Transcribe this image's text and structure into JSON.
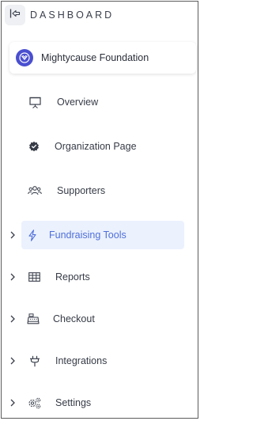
{
  "header": {
    "title": "DASHBOARD"
  },
  "org": {
    "name": "Mightycause Foundation"
  },
  "nav": [
    {
      "label": "Overview"
    },
    {
      "label": "Organization Page"
    },
    {
      "label": "Supporters"
    },
    {
      "label": "Fundraising Tools",
      "active": true
    },
    {
      "label": "Reports"
    },
    {
      "label": "Checkout"
    },
    {
      "label": "Integrations"
    },
    {
      "label": "Settings"
    }
  ],
  "icons": {
    "collapse": "collapse-left-icon",
    "overview": "presentation-icon",
    "organization_page": "verified-badge-icon",
    "supporters": "users-group-icon",
    "fundraising_tools": "lightning-bolt-icon",
    "reports": "table-icon",
    "checkout": "cash-register-icon",
    "integrations": "plug-icon",
    "settings": "gears-icon",
    "expand": "chevron-right-icon"
  },
  "colors": {
    "accent": "#4f6fd9",
    "active_bg": "#ebf1fd",
    "org_logo": "#4a4fd0",
    "text": "#363b46"
  }
}
